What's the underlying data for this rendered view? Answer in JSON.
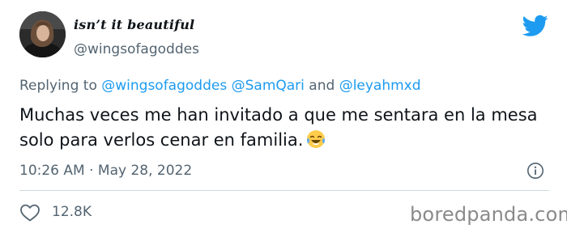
{
  "user": {
    "display_name": "isn’t it beautiful",
    "handle": "@wingsofagoddes"
  },
  "brand_icon": "twitter-bird-icon",
  "reply": {
    "prefix": "Replying to ",
    "mention1": "@wingsofagoddes",
    "mention2": "@SamQari",
    "conjunction": " and ",
    "mention3": "@leyahmxd"
  },
  "tweet": {
    "text": "Muchas veces me han invitado a que me sentara en la mesa solo para verlos cenar en familia.",
    "emoji": "face-with-tears-of-joy"
  },
  "meta": {
    "time": "10:26 AM",
    "separator": " · ",
    "date": "May 28, 2022"
  },
  "likes": {
    "count": "12.8K"
  },
  "watermark": "boredpanda.com",
  "colors": {
    "accent": "#1d9bf0",
    "text": "#0f1419",
    "muted": "#536471"
  }
}
